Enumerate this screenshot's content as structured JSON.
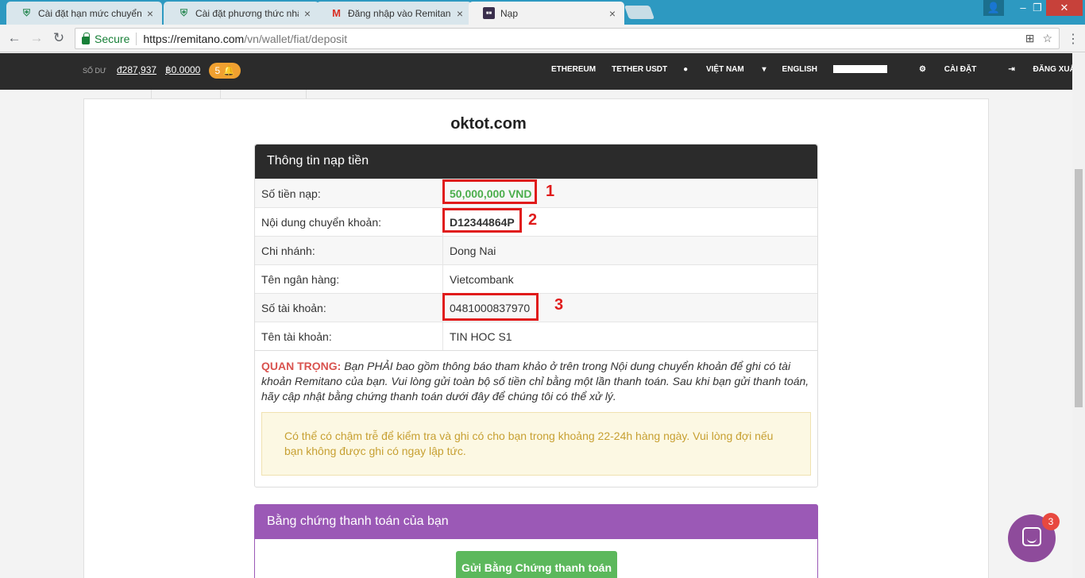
{
  "browser": {
    "tabs": [
      {
        "title": "Cài đặt hạn mức chuyển",
        "icon": "shield-icon"
      },
      {
        "title": "Cài đặt phương thức nhậ",
        "icon": "shield-icon"
      },
      {
        "title": "Đăng nhập vào Remitano",
        "icon": "gmail-icon"
      },
      {
        "title": "Nạp",
        "icon": "remitano-icon"
      }
    ],
    "secure_label": "Secure",
    "url_host": "https://remitano.com",
    "url_path": "/vn/wallet/fiat/deposit"
  },
  "site_nav": {
    "balance_label": "SỐ DƯ",
    "balance_vnd": "đ287,937",
    "balance_btc": "฿0.0000",
    "notifications": "5",
    "links": [
      "ETHEREUM",
      "TETHER USDT",
      "VIỆT NAM",
      "ENGLISH",
      "CÀI ĐẶT",
      "ĐĂNG XUẤT"
    ]
  },
  "watermark": "oktot.com",
  "deposit": {
    "heading": "Thông tin nạp tiền",
    "rows": [
      {
        "key": "Số tiền nạp:",
        "value": "50,000,000 VND"
      },
      {
        "key": "Nội dung chuyển khoản:",
        "value": "D12344864P"
      },
      {
        "key": "Chi nhánh:",
        "value": "Dong Nai"
      },
      {
        "key": "Tên ngân hàng:",
        "value": "Vietcombank"
      },
      {
        "key": "Số tài khoản:",
        "value": "0481000837970"
      },
      {
        "key": "Tên tài khoản:",
        "value": "TIN HOC S1"
      }
    ],
    "marks": [
      "1",
      "2",
      "3"
    ],
    "important_label": "QUAN TRỌNG:",
    "important_text": " Bạn PHẢI bao gồm thông báo tham khảo ở trên trong Nội dung chuyển khoản để ghi có tài khoản Remitano của bạn. Vui lòng gửi toàn bộ số tiền chỉ bằng một lần thanh toán. Sau khi bạn gửi thanh toán, hãy cập nhật bằng chứng thanh toán dưới đây để chúng tôi có thể xử lý.",
    "warning": "Có thể có chậm trễ để kiểm tra và ghi có cho bạn trong khoảng 22-24h hàng ngày. Vui lòng đợi nếu bạn không được ghi có ngay lập tức."
  },
  "proof": {
    "heading": "Bằng chứng thanh toán của bạn",
    "button": "Gửi Bằng Chứng thanh toán"
  },
  "chat_badge": "3",
  "colors": {
    "accent_purple": "#9b59b6",
    "success_green": "#5cb85c",
    "highlight_red": "#e01b1b",
    "tab_strip": "#2d99c1"
  }
}
